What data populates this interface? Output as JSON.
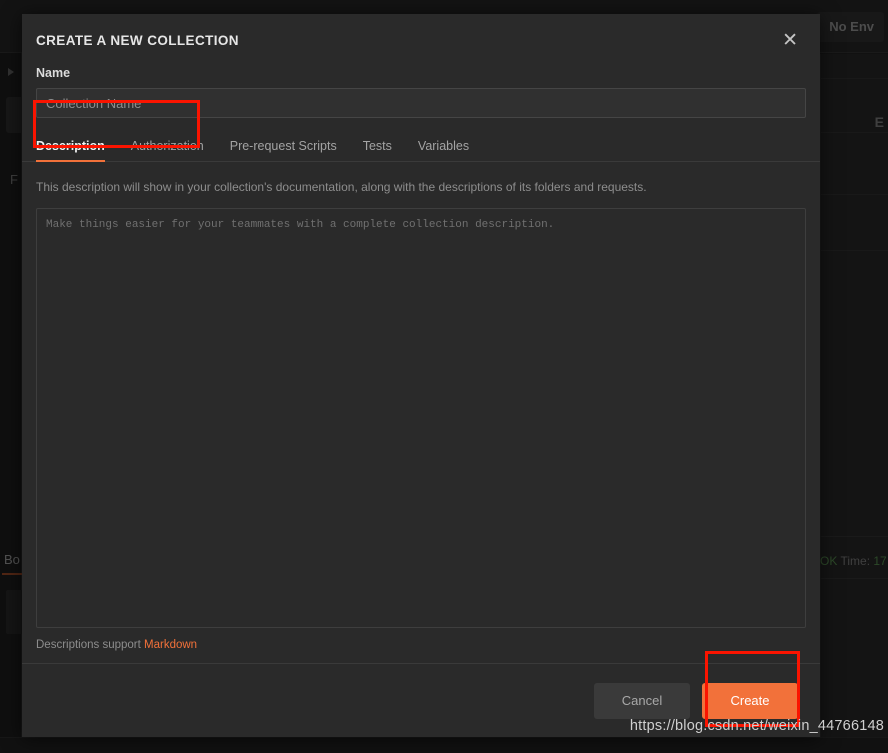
{
  "background": {
    "env_selector_label": "No Env",
    "env_icon": "chevron-down-icon",
    "eye_icon_label": "E",
    "folder_label": "F",
    "response_tab_label": "Bo",
    "status_ok": "OK",
    "status_time_label": "Time:",
    "status_time_value": "17"
  },
  "modal": {
    "title": "CREATE A NEW COLLECTION",
    "close_icon": "close-icon",
    "name": {
      "label": "Name",
      "placeholder": "Collection Name",
      "value": ""
    },
    "tabs": [
      {
        "label": "Description",
        "active": true
      },
      {
        "label": "Authorization",
        "active": false
      },
      {
        "label": "Pre-request Scripts",
        "active": false
      },
      {
        "label": "Tests",
        "active": false
      },
      {
        "label": "Variables",
        "active": false
      }
    ],
    "description": {
      "hint": "This description will show in your collection's documentation, along with the descriptions of its folders and requests.",
      "placeholder": "Make things easier for your teammates with a complete collection description.",
      "value": "",
      "markdown_note_prefix": "Descriptions support",
      "markdown_link": "Markdown"
    },
    "footer": {
      "cancel_label": "Cancel",
      "create_label": "Create"
    }
  },
  "annotations": {
    "highlight_color": "#fb1400",
    "boxes": [
      {
        "name": "name-input-highlight"
      },
      {
        "name": "create-button-highlight"
      }
    ]
  },
  "watermark": {
    "text": "https://blog.csdn.net/weixin_44766148"
  },
  "colors": {
    "accent": "#f2713a",
    "modal_bg": "#2a2a2a",
    "app_bg": "#262626",
    "highlight": "#fb1400",
    "success": "#62a05a"
  }
}
